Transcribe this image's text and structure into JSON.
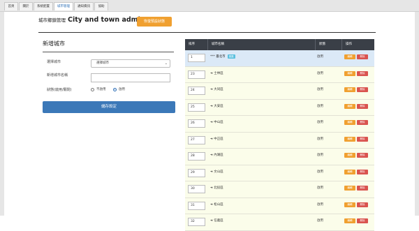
{
  "tabs": [
    {
      "label": "首頁",
      "active": false
    },
    {
      "label": "關於",
      "active": false
    },
    {
      "label": "系統配置",
      "active": false
    },
    {
      "label": "城市管理",
      "active": true
    },
    {
      "label": "通知資訊",
      "active": false
    },
    {
      "label": "協助",
      "active": false
    }
  ],
  "header": {
    "title_zh": "城市鄉鎮管理",
    "title_en": "City and town admin",
    "restore_button": "恢復預設狀態"
  },
  "form": {
    "title": "新增城市",
    "parent_label": "選擇城市",
    "parent_value": "選擇城市",
    "name_label": "新增城市名稱",
    "name_value": "",
    "status_label": "狀態(啟用/關閉)",
    "status_disabled": "不啟用",
    "status_enabled": "啟用",
    "status_selected": "啟用",
    "submit_label": "儲存設定"
  },
  "table": {
    "headers": [
      "排序",
      "城市名稱",
      "狀態",
      "操作"
    ],
    "edit_label": "編輯",
    "delete_label": "刪除",
    "rows": [
      {
        "order": "1",
        "prefix": "***",
        "name": "臺北市",
        "badge": "首頁",
        "status": "啟用"
      },
      {
        "order": "23",
        "prefix": "➜",
        "name": "士林區",
        "status": "啟用"
      },
      {
        "order": "24",
        "prefix": "➜",
        "name": "大同區",
        "status": "啟用"
      },
      {
        "order": "25",
        "prefix": "➜",
        "name": "大安區",
        "status": "啟用"
      },
      {
        "order": "26",
        "prefix": "➜",
        "name": "中山區",
        "status": "啟用"
      },
      {
        "order": "27",
        "prefix": "➜",
        "name": "中正區",
        "status": "啟用"
      },
      {
        "order": "28",
        "prefix": "➜",
        "name": "內湖區",
        "status": "啟用"
      },
      {
        "order": "29",
        "prefix": "➜",
        "name": "文山區",
        "status": "啟用"
      },
      {
        "order": "30",
        "prefix": "➜",
        "name": "北投區",
        "status": "啟用"
      },
      {
        "order": "31",
        "prefix": "➜",
        "name": "松山區",
        "status": "啟用"
      },
      {
        "order": "32",
        "prefix": "➜",
        "name": "信義區",
        "status": "啟用"
      }
    ]
  },
  "colors": {
    "accent": "#3b78b8",
    "warning": "#f0a030",
    "danger": "#d9534f",
    "table_header": "#3a3f47",
    "row_bg": "#fbfdea",
    "row_highlight": "#dbe9f7"
  }
}
